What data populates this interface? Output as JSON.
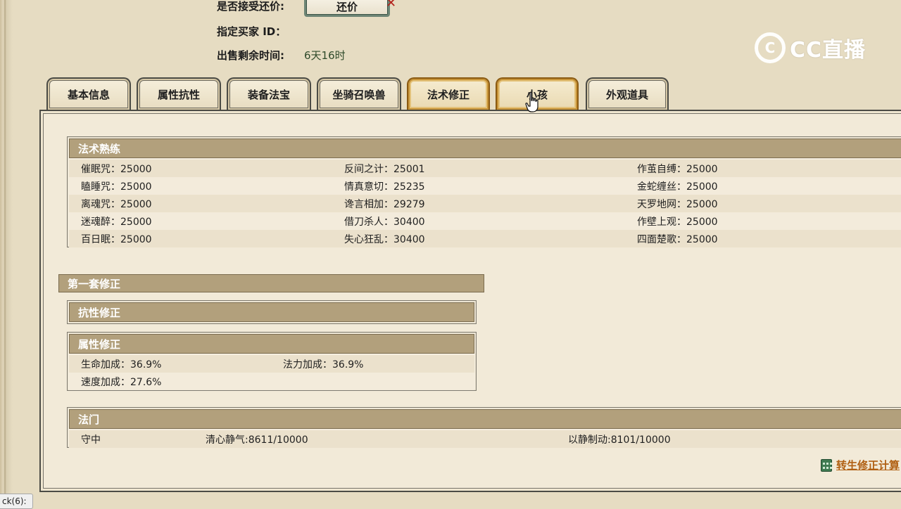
{
  "top": {
    "accept_counter_label": "是否接受还价:",
    "counter_button": "还价",
    "buyer_label": "指定买家 ID：",
    "buyer_value": "",
    "time_label": "出售剩余时间:",
    "time_value": "6天16时"
  },
  "logo": {
    "text": "CC直播"
  },
  "tabs": [
    {
      "label": "基本信息"
    },
    {
      "label": "属性抗性"
    },
    {
      "label": "装备法宝"
    },
    {
      "label": "坐骑召唤兽"
    },
    {
      "label": "法术修正"
    },
    {
      "label": "小孩"
    },
    {
      "label": "外观道具"
    }
  ],
  "spell_mastery": {
    "title": "法术熟练",
    "rows": [
      [
        "催眠咒：25000",
        "反间之计：25001",
        "作茧自缚：25000"
      ],
      [
        "瞌睡咒：25000",
        "情真意切：25235",
        "金蛇缠丝：25000"
      ],
      [
        "离魂咒：25000",
        "谗言相加：29279",
        "天罗地网：25000"
      ],
      [
        "迷魂醉：25000",
        "借刀杀人：30400",
        "作壁上观：25000"
      ],
      [
        "百日眠：25000",
        "失心狂乱：30400",
        "四面楚歌：25000"
      ]
    ]
  },
  "first_set": {
    "title": "第一套修正"
  },
  "resist": {
    "title": "抗性修正"
  },
  "attr": {
    "title": "属性修正",
    "rows": [
      [
        "生命加成：36.9%",
        "法力加成：36.9%"
      ],
      [
        "速度加成：27.6%",
        ""
      ]
    ]
  },
  "famen": {
    "title": "法门",
    "items": [
      "守中",
      "清心静气:8611/10000",
      "以静制动:8101/10000"
    ]
  },
  "calc_link": "转生修正计算",
  "status_text": "ck(6):"
}
